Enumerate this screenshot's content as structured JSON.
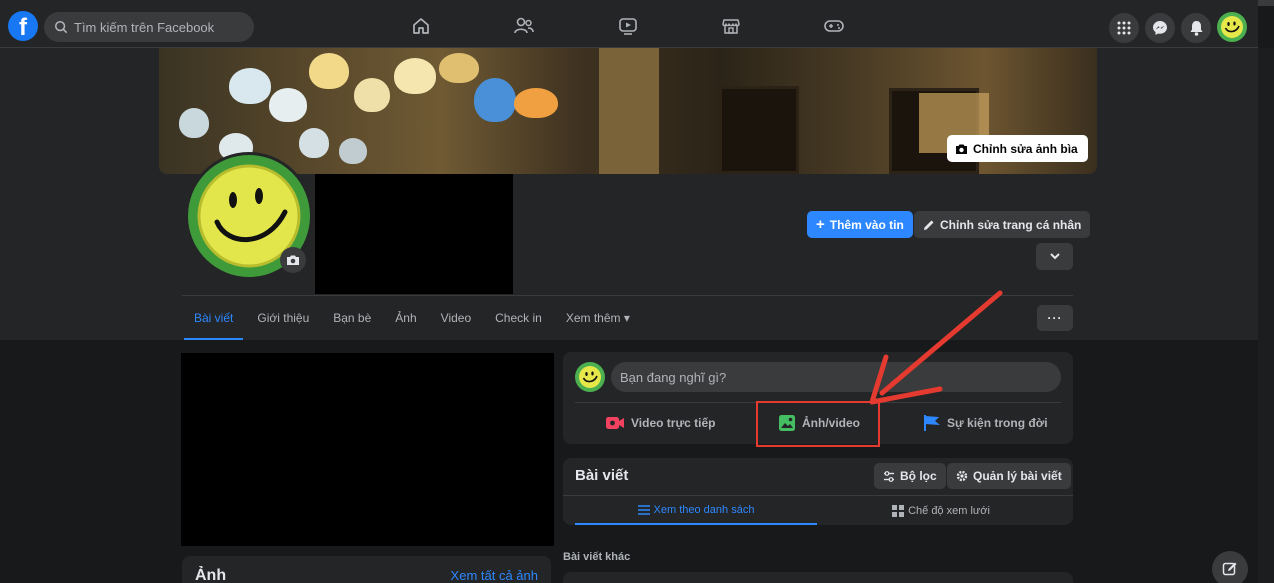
{
  "topbar": {
    "logo": "f",
    "search_placeholder": "Tìm kiếm trên Facebook",
    "nav_icons": [
      "home-icon",
      "friends-icon",
      "watch-icon",
      "marketplace-icon",
      "gaming-icon"
    ],
    "right_icons": [
      "menu-grid-icon",
      "messenger-icon",
      "notifications-icon",
      "account-avatar"
    ]
  },
  "cover": {
    "edit_label": "Chỉnh sửa ảnh bìa"
  },
  "profile": {
    "add_story_label": "Thêm vào tin",
    "edit_profile_label": "Chỉnh sửa trang cá nhân"
  },
  "tabs": [
    {
      "label": "Bài viết",
      "active": true
    },
    {
      "label": "Giới thiệu"
    },
    {
      "label": "Bạn bè"
    },
    {
      "label": "Ảnh"
    },
    {
      "label": "Video"
    },
    {
      "label": "Check in"
    },
    {
      "label": "Xem thêm ▾"
    }
  ],
  "composer": {
    "placeholder": "Bạn đang nghĩ gì?",
    "actions": [
      {
        "label": "Video trực tiếp",
        "icon": "live-video-icon",
        "color": "#f3425f"
      },
      {
        "label": "Ảnh/video",
        "icon": "photo-video-icon",
        "color": "#45bd62"
      },
      {
        "label": "Sự kiện trong đời",
        "icon": "life-event-flag-icon",
        "color": "#2d88ff"
      }
    ]
  },
  "posts": {
    "title": "Bài viết",
    "filter_label": "Bộ lọc",
    "manage_label": "Quản lý bài viết",
    "list_view_label": "Xem theo danh sách",
    "grid_view_label": "Chế độ xem lưới"
  },
  "other_posts_label": "Bài viết khác",
  "photos": {
    "title": "Ảnh",
    "see_all": "Xem tất cả ảnh"
  },
  "colors": {
    "accent": "#2d88ff",
    "annotation": "#e53a2f",
    "surface": "#242526",
    "background": "#18191a"
  }
}
